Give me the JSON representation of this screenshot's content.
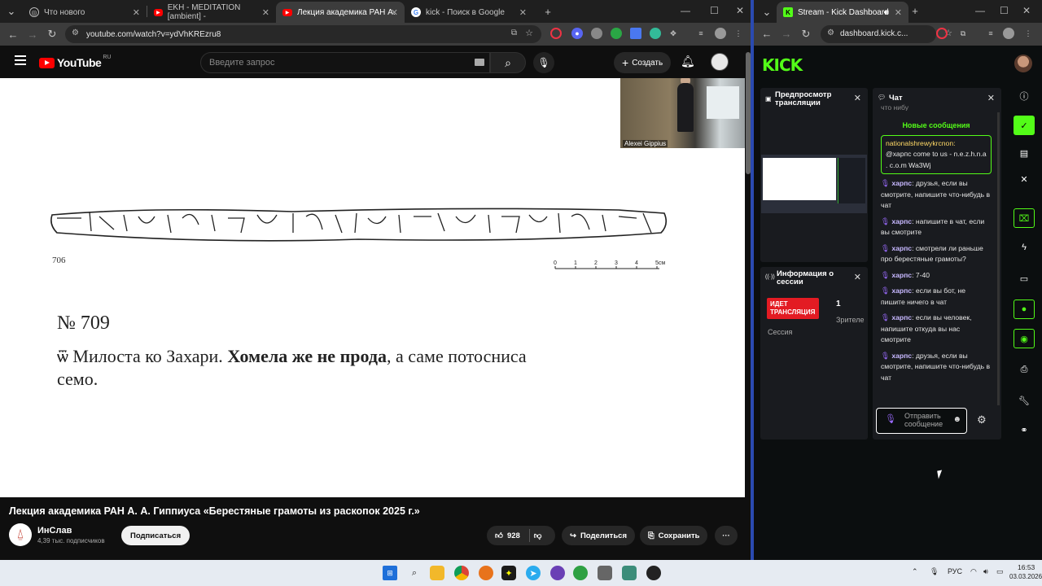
{
  "left_browser": {
    "tabs": [
      {
        "label": "Что нового",
        "icon": "globe-icon"
      },
      {
        "label": "EKH - MEDITATION [ambient] -",
        "icon": "youtube-icon"
      },
      {
        "label": "Лекция академика РАН А.",
        "icon": "youtube-icon",
        "active": true
      },
      {
        "label": "kick - Поиск в Google",
        "icon": "google-icon"
      }
    ],
    "url": "youtube.com/watch?v=ydVhKREzru8"
  },
  "youtube": {
    "logo_text": "YouTube",
    "logo_region": "RU",
    "search_placeholder": "Введите запрос",
    "create_label": "Создать",
    "webcam_caption": "Alexei Gippius",
    "slide": {
      "fragment_number": "706",
      "scale_labels": [
        "0",
        "1",
        "2",
        "3",
        "4",
        "5см"
      ],
      "doc_number": "№ 709",
      "text_plain_1": "ѿ Милоста ко Захари. ",
      "text_bold": "Хомела же не прода",
      "text_plain_2": ", а саме потосниса",
      "text_line2": "семо."
    },
    "video_title": "Лекция академика РАН А. А. Гиппиуса «Берестяные грамоты из раскопок 2025 г.»",
    "channel_name": "ИнСлав",
    "channel_subs": "4,39 тыс. подписчиков",
    "subscribe_label": "Подписаться",
    "likes": "928",
    "share_label": "Поделиться",
    "save_label": "Сохранить"
  },
  "right_browser": {
    "tab_label": "Stream - Kick Dashboard",
    "url": "dashboard.kick.c..."
  },
  "kick": {
    "logo": "KICK",
    "preview_title": "Предпросмотр трансляции",
    "session_title": "Информация о сессии",
    "live_badge": "ИДЕТ ТРАНСЛЯЦИЯ",
    "viewers_count": "1",
    "viewers_label": "Зрителе",
    "session_label": "Сессия",
    "chat_title": "Чат",
    "chat_cut_text": "что нибу",
    "new_messages_label": "Новые сообщения",
    "highlighted": {
      "user": "nationalshrewykrcnon:",
      "text": "@харпс come to us - n.e.z.h.n.a . c.o.m Wa3Wj"
    },
    "messages": [
      {
        "user": "харпс",
        "text": ": друзья, если вы смотрите, напишите что-нибудь в чат"
      },
      {
        "user": "харпс",
        "text": ": напишите в чат, если вы смотрите"
      },
      {
        "user": "харпс",
        "text": ": смотрели ли раньше про берестяные грамоты?"
      },
      {
        "user": "харпс",
        "text": ": 7-40"
      },
      {
        "user": "харпс",
        "text": ": если вы бот, не пишите ничего в чат"
      },
      {
        "user": "харпс",
        "text": ": если вы человек, напишите откуда вы нас смотрите"
      },
      {
        "user": "харпс",
        "text": ": друзья, если вы смотрите, напишите что-нибудь в чат"
      }
    ],
    "chat_placeholder": "Отправить сообщение"
  },
  "taskbar": {
    "lang": "РУС",
    "time": "16:53",
    "date": "03.03.2026"
  },
  "colors": {
    "kick_green": "#53fc18",
    "youtube_red": "#ff0000",
    "live_red": "#e31b23"
  }
}
